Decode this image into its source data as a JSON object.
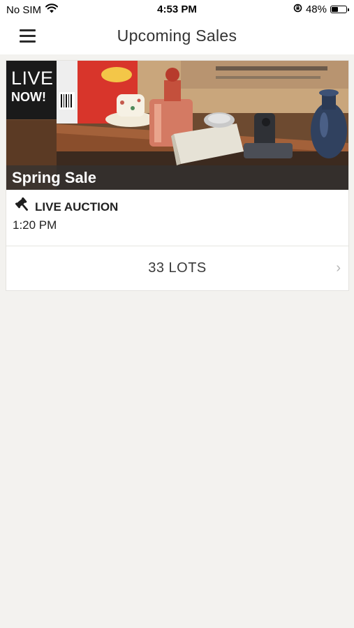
{
  "status_bar": {
    "carrier": "No SIM",
    "time": "4:53 PM",
    "battery_percent": "48%",
    "battery_level": 0.48,
    "icons": [
      "wifi-icon",
      "orientation-lock-icon",
      "battery-icon"
    ]
  },
  "nav": {
    "title": "Upcoming Sales",
    "menu_icon": "hamburger-menu-icon"
  },
  "sale": {
    "badge_line1": "LIVE",
    "badge_line2": "NOW!",
    "name": "Spring Sale",
    "auction_type": "LIVE AUCTION",
    "auction_icon": "gavel-icon",
    "time": "1:20 PM",
    "lots_label": "33 LOTS",
    "chevron": "›"
  },
  "colors": {
    "background": "#f3f2ef",
    "card": "#ffffff",
    "badge": "#1a1a1a"
  }
}
